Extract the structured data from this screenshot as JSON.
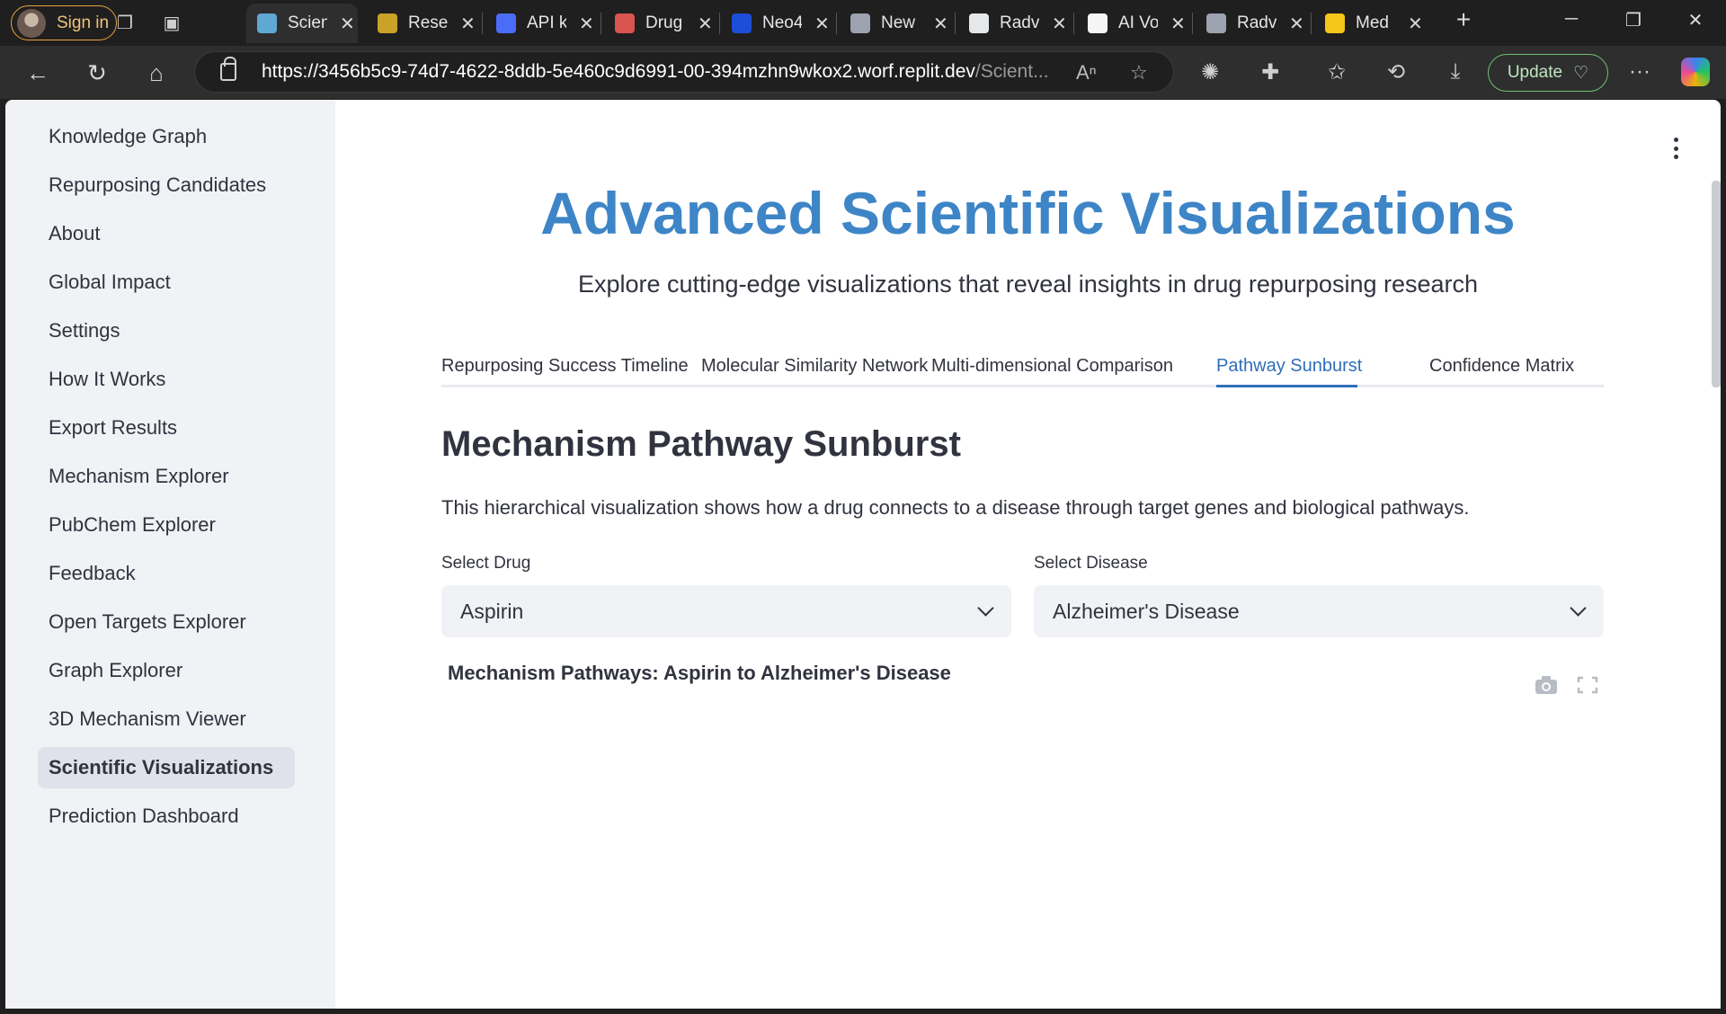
{
  "browser": {
    "sign_in_label": "Sign in",
    "tabs": [
      {
        "title": "Scien",
        "active": true,
        "color": "#5fa8d3"
      },
      {
        "title": "Resea",
        "active": false,
        "color": "#c9a227"
      },
      {
        "title": "API k",
        "active": false,
        "color": "#4a6cf7"
      },
      {
        "title": "Drug",
        "active": false,
        "color": "#d9534f"
      },
      {
        "title": "Neo4",
        "active": false,
        "color": "#1d4ed8"
      },
      {
        "title": "New",
        "active": false,
        "color": "#9ca3af"
      },
      {
        "title": "Radv",
        "active": false,
        "color": "#e5e7eb"
      },
      {
        "title": "AI Vo",
        "active": false,
        "color": "#f5f5f5"
      },
      {
        "title": "Radv",
        "active": false,
        "color": "#9ca3af"
      },
      {
        "title": "Med",
        "active": false,
        "color": "#f5c518"
      }
    ],
    "url_host": "https://3456b5c9-74d7-4622-8ddb-5e460c9d6991-00-394mzhn9wkox2.worf.replit.dev",
    "url_path": "/Scient...",
    "update_label": "Update"
  },
  "sidebar": {
    "items": [
      {
        "label": "Knowledge Graph",
        "active": false
      },
      {
        "label": "Repurposing Candidates",
        "active": false
      },
      {
        "label": "About",
        "active": false
      },
      {
        "label": "Global Impact",
        "active": false
      },
      {
        "label": "Settings",
        "active": false
      },
      {
        "label": "How It Works",
        "active": false
      },
      {
        "label": "Export Results",
        "active": false
      },
      {
        "label": "Mechanism Explorer",
        "active": false
      },
      {
        "label": "PubChem Explorer",
        "active": false
      },
      {
        "label": "Feedback",
        "active": false
      },
      {
        "label": "Open Targets Explorer",
        "active": false
      },
      {
        "label": "Graph Explorer",
        "active": false
      },
      {
        "label": "3D Mechanism Viewer",
        "active": false
      },
      {
        "label": "Scientific Visualizations",
        "active": true
      },
      {
        "label": "Prediction Dashboard",
        "active": false
      }
    ]
  },
  "main": {
    "title": "Advanced Scientific Visualizations",
    "subtitle": "Explore cutting-edge visualizations that reveal insights in drug repurposing research",
    "tabs": [
      {
        "label": "Repurposing Success Timeline",
        "active": false
      },
      {
        "label": "Molecular Similarity Network",
        "active": false
      },
      {
        "label": "Multi-dimensional Comparison",
        "active": false
      },
      {
        "label": "Pathway Sunburst",
        "active": true
      },
      {
        "label": "Confidence Matrix",
        "active": false
      }
    ],
    "section_heading": "Mechanism Pathway Sunburst",
    "section_description": "This hierarchical visualization shows how a drug connects to a disease through target genes and biological pathways.",
    "drug_select": {
      "label": "Select Drug",
      "value": "Aspirin"
    },
    "disease_select": {
      "label": "Select Disease",
      "value": "Alzheimer's Disease"
    },
    "chart_title": "Mechanism Pathways: Aspirin to Alzheimer's Disease"
  },
  "colors": {
    "accent": "#3d85c6",
    "active_tab": "#2f6fba",
    "sidebar_bg": "#f0f2f6",
    "update_border": "#6fbf73"
  }
}
